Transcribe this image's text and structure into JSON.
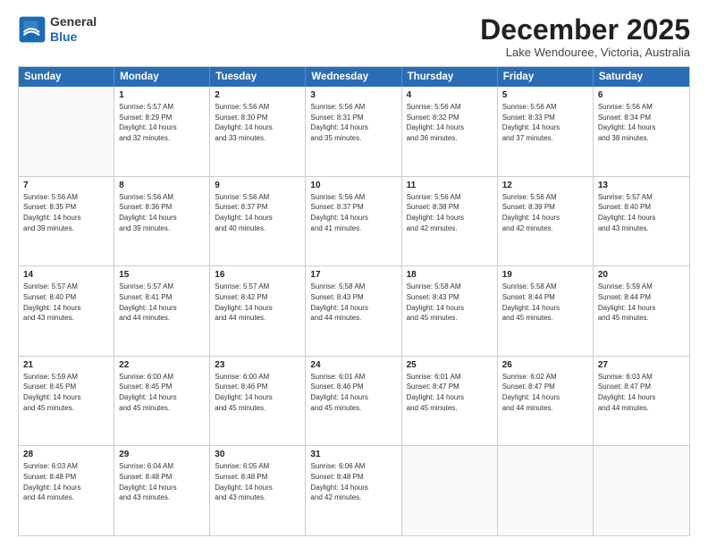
{
  "logo": {
    "line1": "General",
    "line2": "Blue"
  },
  "title": "December 2025",
  "subtitle": "Lake Wendouree, Victoria, Australia",
  "header_days": [
    "Sunday",
    "Monday",
    "Tuesday",
    "Wednesday",
    "Thursday",
    "Friday",
    "Saturday"
  ],
  "rows": [
    [
      {
        "day": "",
        "lines": []
      },
      {
        "day": "1",
        "lines": [
          "Sunrise: 5:57 AM",
          "Sunset: 8:29 PM",
          "Daylight: 14 hours",
          "and 32 minutes."
        ]
      },
      {
        "day": "2",
        "lines": [
          "Sunrise: 5:56 AM",
          "Sunset: 8:30 PM",
          "Daylight: 14 hours",
          "and 33 minutes."
        ]
      },
      {
        "day": "3",
        "lines": [
          "Sunrise: 5:56 AM",
          "Sunset: 8:31 PM",
          "Daylight: 14 hours",
          "and 35 minutes."
        ]
      },
      {
        "day": "4",
        "lines": [
          "Sunrise: 5:56 AM",
          "Sunset: 8:32 PM",
          "Daylight: 14 hours",
          "and 36 minutes."
        ]
      },
      {
        "day": "5",
        "lines": [
          "Sunrise: 5:56 AM",
          "Sunset: 8:33 PM",
          "Daylight: 14 hours",
          "and 37 minutes."
        ]
      },
      {
        "day": "6",
        "lines": [
          "Sunrise: 5:56 AM",
          "Sunset: 8:34 PM",
          "Daylight: 14 hours",
          "and 38 minutes."
        ]
      }
    ],
    [
      {
        "day": "7",
        "lines": [
          "Sunrise: 5:56 AM",
          "Sunset: 8:35 PM",
          "Daylight: 14 hours",
          "and 39 minutes."
        ]
      },
      {
        "day": "8",
        "lines": [
          "Sunrise: 5:56 AM",
          "Sunset: 8:36 PM",
          "Daylight: 14 hours",
          "and 39 minutes."
        ]
      },
      {
        "day": "9",
        "lines": [
          "Sunrise: 5:56 AM",
          "Sunset: 8:37 PM",
          "Daylight: 14 hours",
          "and 40 minutes."
        ]
      },
      {
        "day": "10",
        "lines": [
          "Sunrise: 5:56 AM",
          "Sunset: 8:37 PM",
          "Daylight: 14 hours",
          "and 41 minutes."
        ]
      },
      {
        "day": "11",
        "lines": [
          "Sunrise: 5:56 AM",
          "Sunset: 8:38 PM",
          "Daylight: 14 hours",
          "and 42 minutes."
        ]
      },
      {
        "day": "12",
        "lines": [
          "Sunrise: 5:56 AM",
          "Sunset: 8:39 PM",
          "Daylight: 14 hours",
          "and 42 minutes."
        ]
      },
      {
        "day": "13",
        "lines": [
          "Sunrise: 5:57 AM",
          "Sunset: 8:40 PM",
          "Daylight: 14 hours",
          "and 43 minutes."
        ]
      }
    ],
    [
      {
        "day": "14",
        "lines": [
          "Sunrise: 5:57 AM",
          "Sunset: 8:40 PM",
          "Daylight: 14 hours",
          "and 43 minutes."
        ]
      },
      {
        "day": "15",
        "lines": [
          "Sunrise: 5:57 AM",
          "Sunset: 8:41 PM",
          "Daylight: 14 hours",
          "and 44 minutes."
        ]
      },
      {
        "day": "16",
        "lines": [
          "Sunrise: 5:57 AM",
          "Sunset: 8:42 PM",
          "Daylight: 14 hours",
          "and 44 minutes."
        ]
      },
      {
        "day": "17",
        "lines": [
          "Sunrise: 5:58 AM",
          "Sunset: 8:43 PM",
          "Daylight: 14 hours",
          "and 44 minutes."
        ]
      },
      {
        "day": "18",
        "lines": [
          "Sunrise: 5:58 AM",
          "Sunset: 8:43 PM",
          "Daylight: 14 hours",
          "and 45 minutes."
        ]
      },
      {
        "day": "19",
        "lines": [
          "Sunrise: 5:58 AM",
          "Sunset: 8:44 PM",
          "Daylight: 14 hours",
          "and 45 minutes."
        ]
      },
      {
        "day": "20",
        "lines": [
          "Sunrise: 5:59 AM",
          "Sunset: 8:44 PM",
          "Daylight: 14 hours",
          "and 45 minutes."
        ]
      }
    ],
    [
      {
        "day": "21",
        "lines": [
          "Sunrise: 5:59 AM",
          "Sunset: 8:45 PM",
          "Daylight: 14 hours",
          "and 45 minutes."
        ]
      },
      {
        "day": "22",
        "lines": [
          "Sunrise: 6:00 AM",
          "Sunset: 8:45 PM",
          "Daylight: 14 hours",
          "and 45 minutes."
        ]
      },
      {
        "day": "23",
        "lines": [
          "Sunrise: 6:00 AM",
          "Sunset: 8:46 PM",
          "Daylight: 14 hours",
          "and 45 minutes."
        ]
      },
      {
        "day": "24",
        "lines": [
          "Sunrise: 6:01 AM",
          "Sunset: 8:46 PM",
          "Daylight: 14 hours",
          "and 45 minutes."
        ]
      },
      {
        "day": "25",
        "lines": [
          "Sunrise: 6:01 AM",
          "Sunset: 8:47 PM",
          "Daylight: 14 hours",
          "and 45 minutes."
        ]
      },
      {
        "day": "26",
        "lines": [
          "Sunrise: 6:02 AM",
          "Sunset: 8:47 PM",
          "Daylight: 14 hours",
          "and 44 minutes."
        ]
      },
      {
        "day": "27",
        "lines": [
          "Sunrise: 6:03 AM",
          "Sunset: 8:47 PM",
          "Daylight: 14 hours",
          "and 44 minutes."
        ]
      }
    ],
    [
      {
        "day": "28",
        "lines": [
          "Sunrise: 6:03 AM",
          "Sunset: 8:48 PM",
          "Daylight: 14 hours",
          "and 44 minutes."
        ]
      },
      {
        "day": "29",
        "lines": [
          "Sunrise: 6:04 AM",
          "Sunset: 8:48 PM",
          "Daylight: 14 hours",
          "and 43 minutes."
        ]
      },
      {
        "day": "30",
        "lines": [
          "Sunrise: 6:05 AM",
          "Sunset: 8:48 PM",
          "Daylight: 14 hours",
          "and 43 minutes."
        ]
      },
      {
        "day": "31",
        "lines": [
          "Sunrise: 6:06 AM",
          "Sunset: 8:48 PM",
          "Daylight: 14 hours",
          "and 42 minutes."
        ]
      },
      {
        "day": "",
        "lines": []
      },
      {
        "day": "",
        "lines": []
      },
      {
        "day": "",
        "lines": []
      }
    ]
  ]
}
